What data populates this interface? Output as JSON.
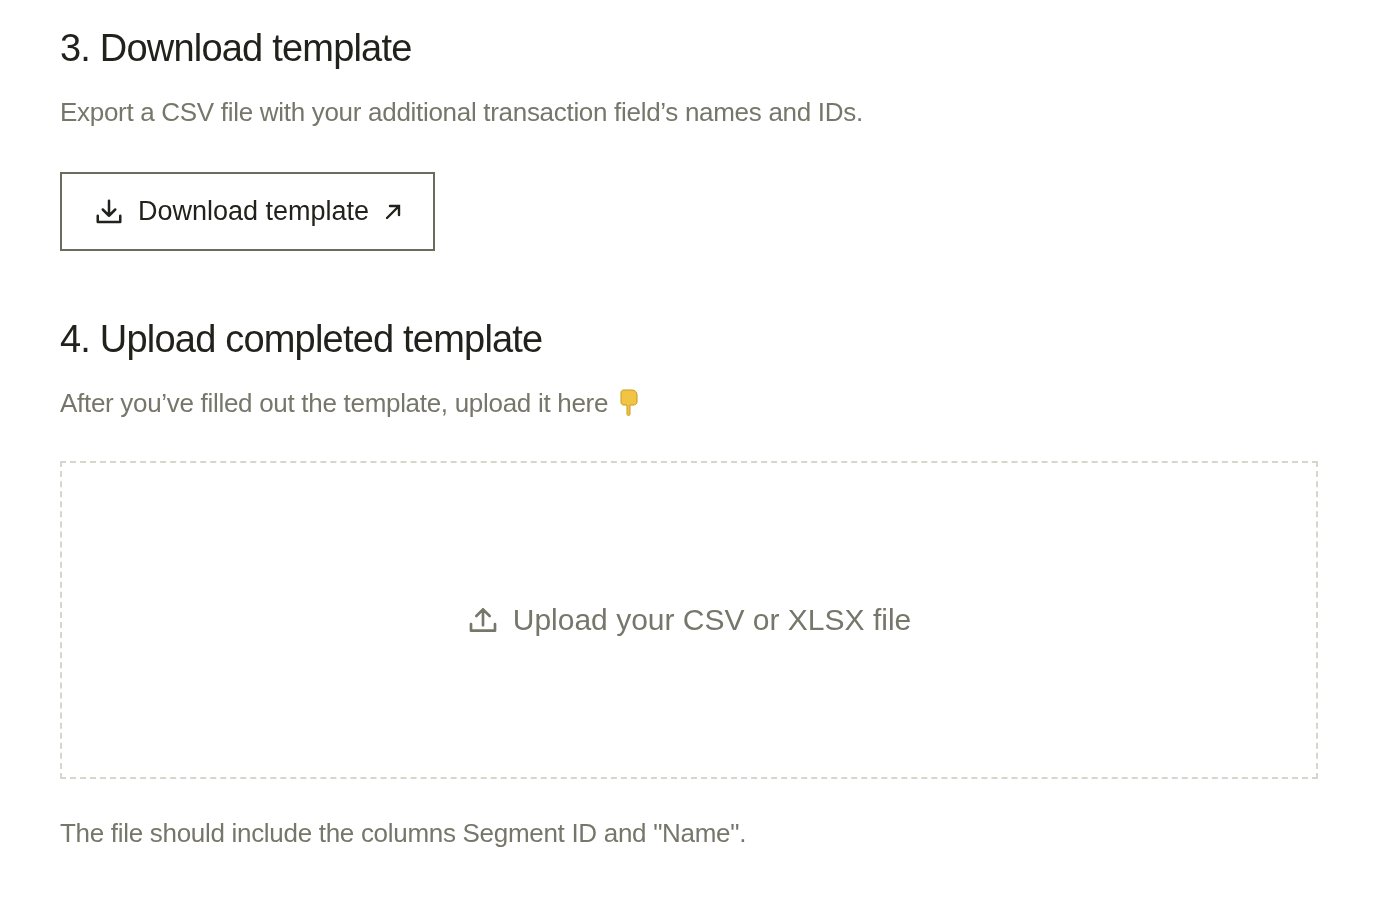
{
  "sections": [
    {
      "heading": "3. Download template",
      "description": "Export a CSV file with your additional transaction field’s names and IDs.",
      "kind": "download",
      "button": {
        "label": "Download template"
      }
    },
    {
      "heading": "4. Upload completed template",
      "description": "After you’ve filled out the template, upload it here",
      "kind": "upload",
      "dropzone": {
        "label": "Upload your CSV or XLSX file"
      },
      "note": "The file should include the columns Segment ID and \"Name\"."
    }
  ]
}
